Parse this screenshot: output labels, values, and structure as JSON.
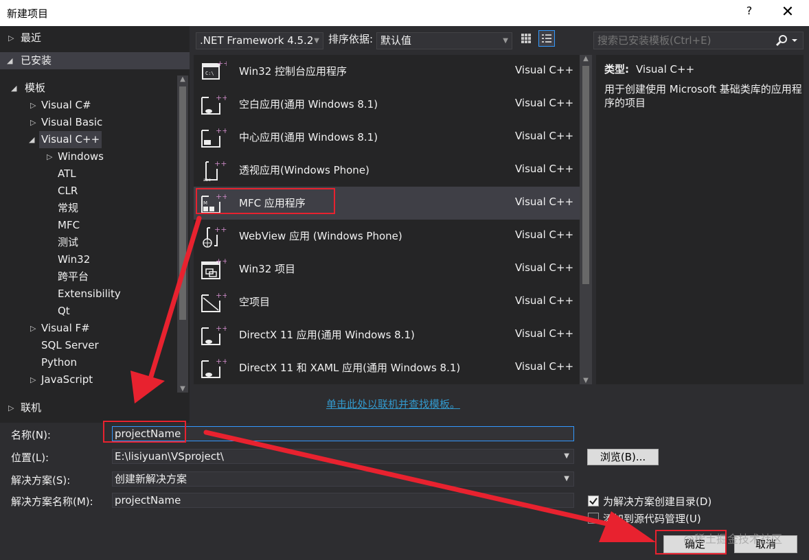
{
  "window": {
    "title": "新建项目",
    "help": "?",
    "close": "✕"
  },
  "tree": {
    "recent": "最近",
    "installed": "已安装",
    "templates": "模板",
    "items": [
      "Visual C#",
      "Visual Basic",
      "Visual C++",
      "Windows",
      "ATL",
      "CLR",
      "常规",
      "MFC",
      "测试",
      "Win32",
      "跨平台",
      "Extensibility",
      "Qt",
      "Visual F#",
      "SQL Server",
      "Python",
      "JavaScript"
    ],
    "online": "联机"
  },
  "toolbar": {
    "framework": ".NET Framework 4.5.2",
    "sort_label": "排序依据:",
    "sort_value": "默认值"
  },
  "templates": [
    {
      "name": "Win32 控制台应用程序",
      "lang": "Visual C++",
      "icon": "console-app-icon"
    },
    {
      "name": "空白应用(通用 Windows 8.1)",
      "lang": "Visual C++",
      "icon": "blank-app-icon"
    },
    {
      "name": "中心应用(通用 Windows 8.1)",
      "lang": "Visual C++",
      "icon": "hub-app-icon"
    },
    {
      "name": "透视应用(Windows Phone)",
      "lang": "Visual C++",
      "icon": "pivot-app-icon"
    },
    {
      "name": "MFC 应用程序",
      "lang": "Visual C++",
      "icon": "mfc-app-icon"
    },
    {
      "name": "WebView 应用 (Windows Phone)",
      "lang": "Visual C++",
      "icon": "webview-app-icon"
    },
    {
      "name": "Win32 项目",
      "lang": "Visual C++",
      "icon": "win32-project-icon"
    },
    {
      "name": "空项目",
      "lang": "Visual C++",
      "icon": "empty-project-icon"
    },
    {
      "name": "DirectX 11 应用(通用 Windows 8.1)",
      "lang": "Visual C++",
      "icon": "directx-app-icon"
    },
    {
      "name": "DirectX 11 和 XAML 应用(通用 Windows 8.1)",
      "lang": "Visual C++",
      "icon": "directx-xaml-app-icon"
    }
  ],
  "online_link": "单击此处以联机并查找模板。",
  "search": {
    "placeholder": "搜索已安装模板(Ctrl+E)"
  },
  "info": {
    "type_label": "类型:",
    "type_value": "Visual C++",
    "description": "用于创建使用 Microsoft 基础类库的应用程序的项目"
  },
  "form": {
    "name_label": "名称(N):",
    "name_value": "projectName",
    "location_label": "位置(L):",
    "location_value": "E:\\lisiyuan\\VSproject\\",
    "browse": "浏览(B)...",
    "solution_label": "解决方案(S):",
    "solution_value": "创建新解决方案",
    "solution_name_label": "解决方案名称(M):",
    "solution_name_value": "projectName",
    "create_dir": "为解决方案创建目录(D)",
    "add_source_control": "添加到源代码管理(U)",
    "ok": "确定",
    "cancel": "取消"
  },
  "watermark": "@稀土掘金技术社区",
  "colors": {
    "background": "#2d2d30",
    "panel": "#252526",
    "selected": "#3f3f46",
    "accent": "#3399ff",
    "annotation": "#e8222f",
    "plus_badge": "#c586c0"
  }
}
